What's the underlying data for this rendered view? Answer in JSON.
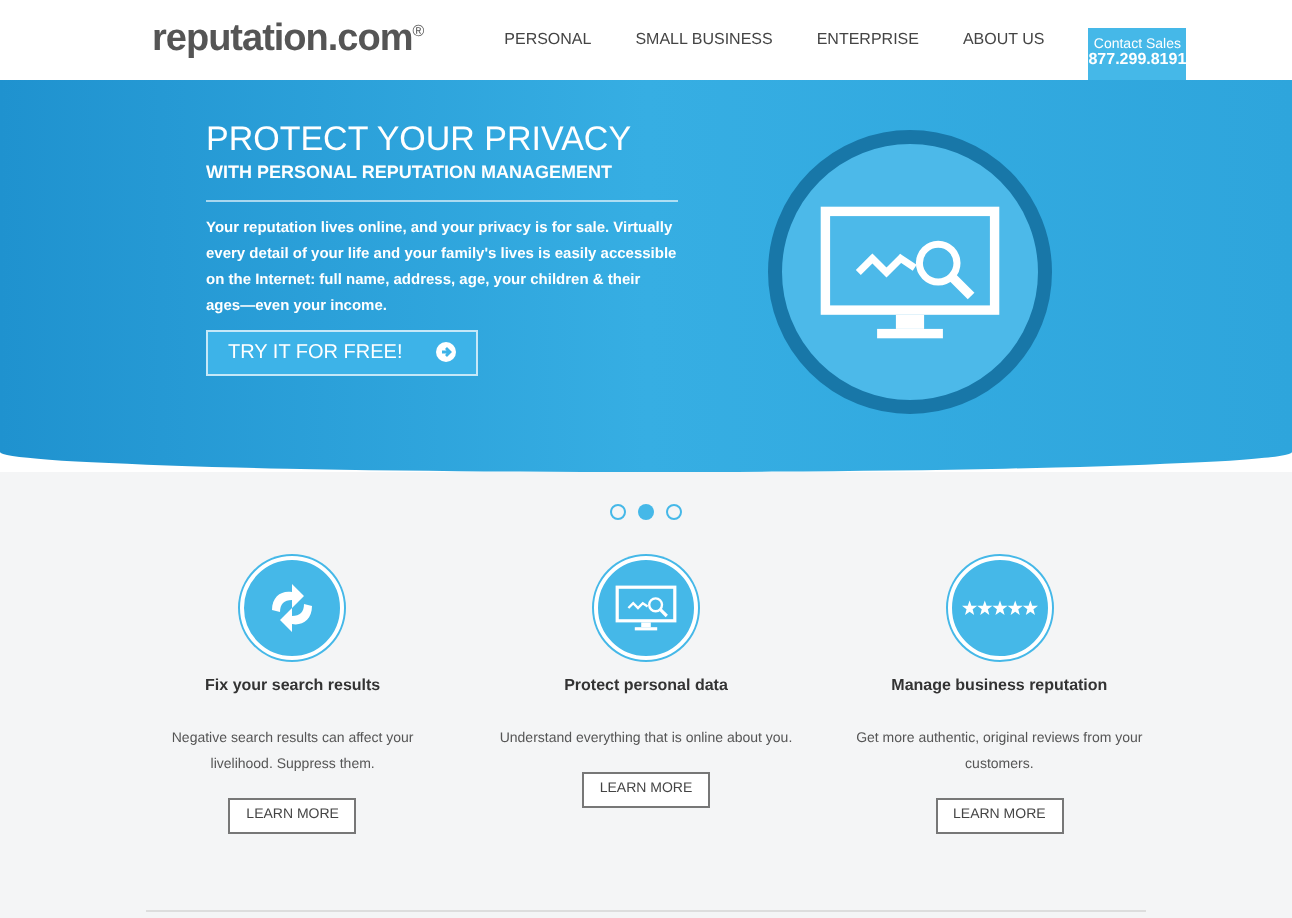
{
  "logo": {
    "text": "reputation.com",
    "mark": "®"
  },
  "nav": [
    "PERSONAL",
    "SMALL BUSINESS",
    "ENTERPRISE",
    "ABOUT US"
  ],
  "contact": {
    "label": "Contact Sales",
    "phone": "877.299.8191"
  },
  "hero": {
    "title": "PROTECT YOUR PRIVACY",
    "subtitle": "WITH PERSONAL REPUTATION MANAGEMENT",
    "body": "Your reputation lives online, and your privacy is for sale. Virtually every detail of your life and your family's lives is easily accessible on the Internet: full name, address, age, your children & their ages—even your income.",
    "cta": "TRY IT FOR FREE!"
  },
  "slides": [
    {
      "selected": false
    },
    {
      "selected": true
    },
    {
      "selected": false
    }
  ],
  "features": [
    {
      "kind": "refresh",
      "title": "Fix your search results",
      "text": "Negative search results can affect your livelihood. Suppress them.",
      "button": "LEARN MORE"
    },
    {
      "kind": "monitor",
      "title": "Protect personal data",
      "text": "Understand everything that is online about you.",
      "button": "LEARN MORE"
    },
    {
      "kind": "stars",
      "title": "Manage business reputation",
      "text": "Get more authentic, original reviews from your customers.",
      "button": "LEARN MORE"
    }
  ]
}
